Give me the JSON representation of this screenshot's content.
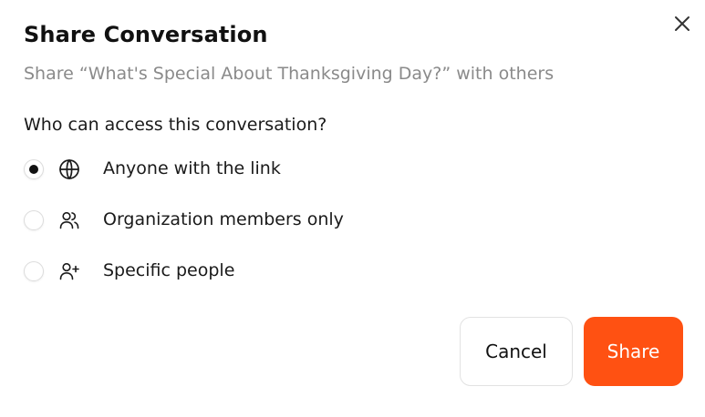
{
  "dialog": {
    "title": "Share Conversation",
    "subtitle": "Share “What's Special About Thanksgiving Day?” with others",
    "close_icon": "close-icon"
  },
  "access": {
    "question": "Who can access this conversation?",
    "selected": "anyone",
    "options": [
      {
        "id": "anyone",
        "label": "Anyone with the link",
        "icon": "globe-icon",
        "checked": true
      },
      {
        "id": "org",
        "label": "Organization members only",
        "icon": "users-icon",
        "checked": false
      },
      {
        "id": "specific",
        "label": "Specific people",
        "icon": "user-plus-icon",
        "checked": false
      }
    ]
  },
  "actions": {
    "cancel_label": "Cancel",
    "share_label": "Share"
  },
  "colors": {
    "accent": "#ff5112",
    "text": "#111111",
    "muted": "#8a8a8a"
  }
}
